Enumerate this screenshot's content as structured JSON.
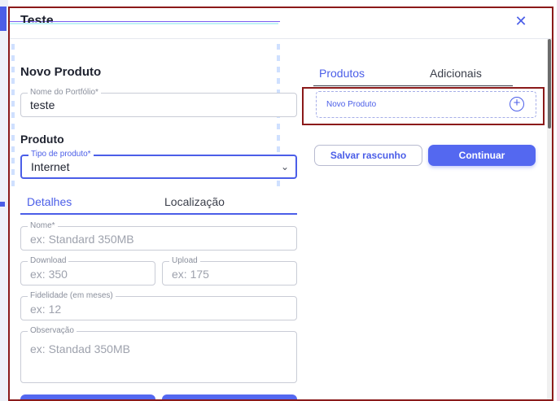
{
  "modal": {
    "title": "Teste"
  },
  "left": {
    "new_product_title": "Novo Produto",
    "portfolio_name": {
      "label": "Nome do Portfólio*",
      "value": "teste"
    },
    "product_title": "Produto",
    "product_type": {
      "label": "Tipo de produto*",
      "value": "Internet"
    },
    "tabs": [
      {
        "label": "Detalhes",
        "active": true
      },
      {
        "label": "Localização",
        "active": false
      }
    ],
    "fields": {
      "name": {
        "label": "Nome*",
        "placeholder": "ex: Standard 350MB"
      },
      "download": {
        "label": "Download",
        "placeholder": "ex: 350"
      },
      "upload": {
        "label": "Upload",
        "placeholder": "ex: 175"
      },
      "loyalty": {
        "label": "Fidelidade (em meses)",
        "placeholder": "ex: 12"
      },
      "notes": {
        "label": "Observação",
        "placeholder": "ex: Standad 350MB"
      }
    }
  },
  "right": {
    "tabs": [
      {
        "label": "Produtos",
        "active": true
      },
      {
        "label": "Adicionais",
        "active": false
      }
    ],
    "product_card_label": "Novo Produto",
    "save_draft": "Salvar rascunho",
    "continue": "Continuar"
  },
  "icons": {
    "close": "close-icon",
    "chevron": "chevron-down-icon",
    "add": "plus-circle-icon"
  },
  "colors": {
    "accent": "#4b5ee8",
    "primary_button": "#5468f0",
    "highlight_border": "#8b1a1a"
  }
}
